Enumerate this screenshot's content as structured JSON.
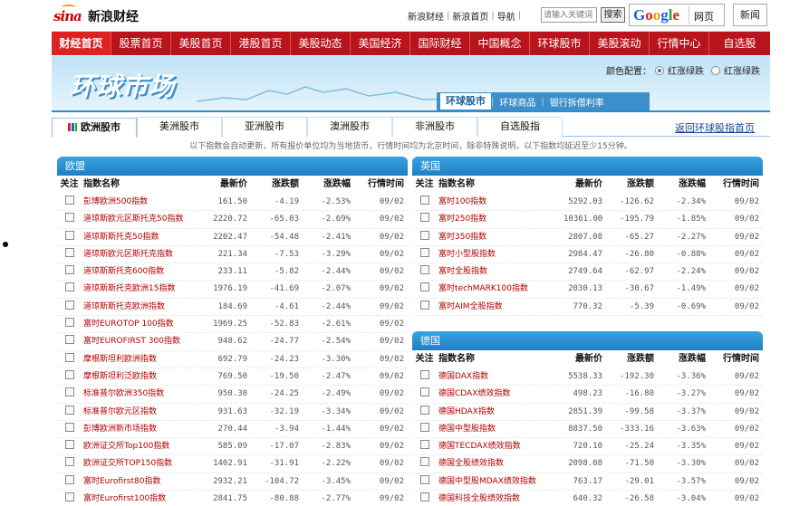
{
  "header": {
    "brand": "新浪财经",
    "top_links": [
      "新浪财经",
      "新浪首页",
      "导航"
    ],
    "search_placeholder": "请输入关键词",
    "search_button": "搜索",
    "google_web": "网页",
    "news_button": "新闻"
  },
  "nav": [
    {
      "label": "财经首页",
      "active": true
    },
    {
      "label": "股票首页"
    },
    {
      "label": "美股首页"
    },
    {
      "label": "港股首页"
    },
    {
      "label": "美股动态"
    },
    {
      "label": "美国经济"
    },
    {
      "label": "国际财经"
    },
    {
      "label": "中国概念"
    },
    {
      "label": "环球股市"
    },
    {
      "label": "美股滚动"
    },
    {
      "label": "行情中心"
    },
    {
      "label": "自选股"
    }
  ],
  "banner": {
    "title": "环球市场",
    "color_setting_label": "颜色配置：",
    "color_options": [
      "红涨绿跌",
      "红涨绿跌"
    ],
    "tabs": [
      "环球股市",
      "环球商品",
      "银行拆借利率"
    ]
  },
  "region_tabs": [
    "欧洲股市",
    "美洲股市",
    "亚洲股市",
    "澳洲股市",
    "非洲股市",
    "自选股指"
  ],
  "return_link": "返回环球股指首页",
  "notice": "以下指数会自动更新，所有报价单位均为当地货币，行情时间均为北京时间，除非特殊说明，以下指数均延迟至少15分钟。",
  "columns": [
    "关注",
    "指数名称",
    "最新价",
    "涨跌额",
    "涨跌幅",
    "行情时间"
  ],
  "panels": {
    "europe": {
      "title": "欧盟",
      "rows": [
        [
          "彭博欧洲500指数",
          "161.50",
          "-4.19",
          "-2.53%",
          "09/02"
        ],
        [
          "道琼斯欧元区斯托克50指数",
          "2220.72",
          "-65.03",
          "-2.69%",
          "09/02"
        ],
        [
          "道琼斯斯托克50指数",
          "2202.47",
          "-54.48",
          "-2.41%",
          "09/02"
        ],
        [
          "道琼斯欧元区斯托克指数",
          "221.34",
          "-7.53",
          "-3.29%",
          "09/02"
        ],
        [
          "道琼斯斯托克600指数",
          "233.11",
          "-5.82",
          "-2.44%",
          "09/02"
        ],
        [
          "道琼斯斯托克欧洲15指数",
          "1976.19",
          "-41.69",
          "-2.07%",
          "09/02"
        ],
        [
          "道琼斯斯托克欧洲指数",
          "184.69",
          "-4.61",
          "-2.44%",
          "09/02"
        ],
        [
          "富时EUROTOP 100指数",
          "1969.25",
          "-52.83",
          "-2.61%",
          "09/02"
        ],
        [
          "富时EUROFIRST 300指数",
          "948.62",
          "-24.77",
          "-2.54%",
          "09/02"
        ],
        [
          "摩根斯坦利欧洲指数",
          "692.79",
          "-24.23",
          "-3.30%",
          "09/02"
        ],
        [
          "摩根斯坦利泛欧指数",
          "769.50",
          "-19.50",
          "-2.47%",
          "09/02"
        ],
        [
          "标准普尔欧洲350指数",
          "950.30",
          "-24.25",
          "-2.49%",
          "09/02"
        ],
        [
          "标准普尔欧元区指数",
          "931.63",
          "-32.19",
          "-3.34%",
          "09/02"
        ],
        [
          "彭博欧洲新市场指数",
          "270.44",
          "-3.94",
          "-1.44%",
          "09/02"
        ],
        [
          "欧洲证交所Top100指数",
          "585.09",
          "-17.07",
          "-2.83%",
          "09/02"
        ],
        [
          "欧洲证交所TOP150指数",
          "1402.91",
          "-31.91",
          "-2.22%",
          "09/02"
        ],
        [
          "富时Eurofirst80指数",
          "2932.21",
          "-104.72",
          "-3.45%",
          "09/02"
        ],
        [
          "富时Eurofirst100指数",
          "2841.75",
          "-80.88",
          "-2.77%",
          "09/02"
        ]
      ]
    },
    "uk": {
      "title": "英国",
      "rows": [
        [
          "富时100指数",
          "5292.03",
          "-126.62",
          "-2.34%",
          "09/02"
        ],
        [
          "富时250指数",
          "10361.00",
          "-195.79",
          "-1.85%",
          "09/02"
        ],
        [
          "富时350指数",
          "2807.08",
          "-65.27",
          "-2.27%",
          "09/02"
        ],
        [
          "富时小型股指数",
          "2984.47",
          "-26.80",
          "-0.88%",
          "09/02"
        ],
        [
          "富时全股指数",
          "2749.64",
          "-62.97",
          "-2.24%",
          "09/02"
        ],
        [
          "富时techMARK100指数",
          "2030.13",
          "-30.67",
          "-1.49%",
          "09/02"
        ],
        [
          "富时AIM全股指数",
          "770.32",
          "-5.39",
          "-0.69%",
          "09/02"
        ]
      ]
    },
    "germany": {
      "title": "德国",
      "rows": [
        [
          "德国DAX指数",
          "5538.33",
          "-192.30",
          "-3.36%",
          "09/02"
        ],
        [
          "德国CDAX绩效指数",
          "498.23",
          "-16.80",
          "-3.27%",
          "09/02"
        ],
        [
          "德国HDAX指数",
          "2851.39",
          "-99.58",
          "-3.37%",
          "09/02"
        ],
        [
          "德国中型股指数",
          "8837.50",
          "-333.16",
          "-3.63%",
          "09/02"
        ],
        [
          "德国TECDAX绩效指数",
          "720.10",
          "-25.24",
          "-3.35%",
          "09/02"
        ],
        [
          "德国全股绩效指数",
          "2098.08",
          "-71.50",
          "-3.30%",
          "09/02"
        ],
        [
          "德国中型股MDAX绩效指数",
          "763.17",
          "-29.01",
          "-3.57%",
          "09/02"
        ],
        [
          "德国科技全股绩效指数",
          "640.32",
          "-26.58",
          "-3.04%",
          "09/02"
        ]
      ]
    }
  }
}
